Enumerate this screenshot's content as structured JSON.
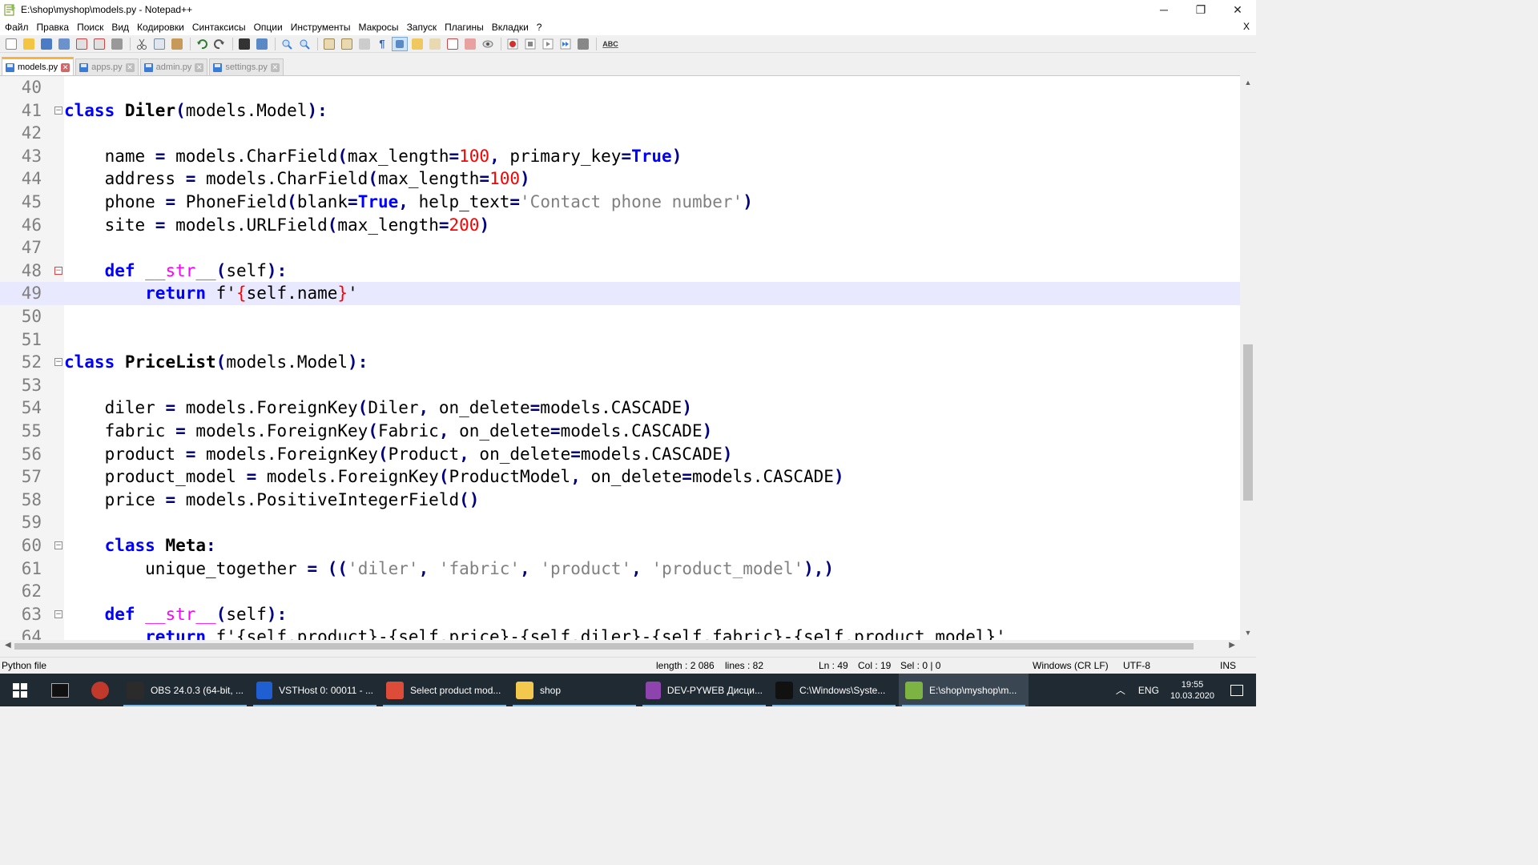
{
  "window": {
    "title": "E:\\shop\\myshop\\models.py - Notepad++",
    "minimize": "─",
    "maximize": "❐",
    "close": "✕"
  },
  "menu": {
    "items": [
      "Файл",
      "Правка",
      "Поиск",
      "Вид",
      "Кодировки",
      "Синтаксисы",
      "Опции",
      "Инструменты",
      "Макросы",
      "Запуск",
      "Плагины",
      "Вкладки",
      "?"
    ],
    "close_doc": "X"
  },
  "toolbar": {
    "spellcheck_label": "ABC"
  },
  "tabs": [
    {
      "label": "models.py",
      "active": true
    },
    {
      "label": "apps.py",
      "active": false
    },
    {
      "label": "admin.py",
      "active": false
    },
    {
      "label": "settings.py",
      "active": false
    }
  ],
  "editor": {
    "current_line": 49,
    "lines": [
      {
        "n": "40",
        "fold": "",
        "html": ""
      },
      {
        "n": "41",
        "fold": "⊟",
        "html": "<span class='kw'>class</span> <span class='cls'>Diler</span><span class='op'>(</span>models.Model<span class='op'>):</span>"
      },
      {
        "n": "42",
        "fold": "",
        "html": ""
      },
      {
        "n": "43",
        "fold": "",
        "html": "    name <span class='op'>=</span> models.CharField<span class='op'>(</span>max_length<span class='op'>=</span><span class='num'>100</span><span class='op'>,</span> primary_key<span class='op'>=</span><span class='kw'>True</span><span class='op'>)</span>"
      },
      {
        "n": "44",
        "fold": "",
        "html": "    address <span class='op'>=</span> models.CharField<span class='op'>(</span>max_length<span class='op'>=</span><span class='num'>100</span><span class='op'>)</span>"
      },
      {
        "n": "45",
        "fold": "",
        "html": "    phone <span class='op'>=</span> PhoneField<span class='op'>(</span>blank<span class='op'>=</span><span class='kw'>True</span><span class='op'>,</span> help_text<span class='op'>=</span><span class='str'>'Contact phone number'</span><span class='op'>)</span>"
      },
      {
        "n": "46",
        "fold": "",
        "html": "    site <span class='op'>=</span> models.URLField<span class='op'>(</span>max_length<span class='op'>=</span><span class='num'>200</span><span class='op'>)</span>"
      },
      {
        "n": "47",
        "fold": "",
        "html": ""
      },
      {
        "n": "48",
        "fold": "⊟",
        "html": "    <span class='kw'>def</span> <span class='magic'>__str__</span><span class='op'>(</span>self<span class='op'>):</span>"
      },
      {
        "n": "49",
        "fold": "",
        "html": "        <span class='kw'>return</span> f'<span class='brace'>{</span>self.name<span class='brace'>}</span>'"
      },
      {
        "n": "50",
        "fold": "",
        "html": ""
      },
      {
        "n": "51",
        "fold": "",
        "html": ""
      },
      {
        "n": "52",
        "fold": "⊟",
        "html": "<span class='kw'>class</span> <span class='cls'>PriceList</span><span class='op'>(</span>models.Model<span class='op'>):</span>"
      },
      {
        "n": "53",
        "fold": "",
        "html": ""
      },
      {
        "n": "54",
        "fold": "",
        "html": "    diler <span class='op'>=</span> models.ForeignKey<span class='op'>(</span>Diler<span class='op'>,</span> on_delete<span class='op'>=</span>models.CASCADE<span class='op'>)</span>"
      },
      {
        "n": "55",
        "fold": "",
        "html": "    fabric <span class='op'>=</span> models.ForeignKey<span class='op'>(</span>Fabric<span class='op'>,</span> on_delete<span class='op'>=</span>models.CASCADE<span class='op'>)</span>"
      },
      {
        "n": "56",
        "fold": "",
        "html": "    product <span class='op'>=</span> models.ForeignKey<span class='op'>(</span>Product<span class='op'>,</span> on_delete<span class='op'>=</span>models.CASCADE<span class='op'>)</span>"
      },
      {
        "n": "57",
        "fold": "",
        "html": "    product_model <span class='op'>=</span> models.ForeignKey<span class='op'>(</span>ProductModel<span class='op'>,</span> on_delete<span class='op'>=</span>models.CASCADE<span class='op'>)</span>"
      },
      {
        "n": "58",
        "fold": "",
        "html": "    price <span class='op'>=</span> models.PositiveIntegerField<span class='op'>()</span>"
      },
      {
        "n": "59",
        "fold": "",
        "html": ""
      },
      {
        "n": "60",
        "fold": "⊟",
        "html": "    <span class='kw'>class</span> <span class='cls'>Meta</span><span class='op'>:</span>"
      },
      {
        "n": "61",
        "fold": "",
        "html": "        unique_together <span class='op'>=</span> <span class='op'>((</span><span class='str'>'diler'</span><span class='op'>,</span> <span class='str'>'fabric'</span><span class='op'>,</span> <span class='str'>'product'</span><span class='op'>,</span> <span class='str'>'product_model'</span><span class='op'>),)</span>"
      },
      {
        "n": "62",
        "fold": "",
        "html": ""
      },
      {
        "n": "63",
        "fold": "⊟",
        "html": "    <span class='kw'>def</span> <span class='magic'>__str__</span><span class='op'>(</span>self<span class='op'>):</span>"
      },
      {
        "n": "64",
        "fold": "",
        "html": "        <span class='kw'>return</span> f'{self.product}-{self.price}-{self.diler}-{self.fabric}-{self.product_model}'"
      }
    ]
  },
  "status": {
    "file_type": "Python file",
    "length": "length : 2 086",
    "lines": "lines : 82",
    "ln": "Ln : 49",
    "col": "Col : 19",
    "sel": "Sel : 0 | 0",
    "eol": "Windows (CR LF)",
    "encoding": "UTF-8",
    "mode": "INS"
  },
  "taskbar": {
    "items": [
      {
        "label": "OBS 24.0.3 (64-bit, ...",
        "color": "#2b2b2b"
      },
      {
        "label": "VSTHost 0: 00011 - ...",
        "color": "#1f5fd1"
      },
      {
        "label": "Select product mod...",
        "color": "#dd4b39"
      },
      {
        "label": "shop",
        "color": "#f2c94c"
      },
      {
        "label": "DEV-PYWEB Дисци...",
        "color": "#8e44ad"
      },
      {
        "label": "C:\\Windows\\Syste...",
        "color": "#111111"
      },
      {
        "label": "E:\\shop\\myshop\\m...",
        "color": "#7cb342"
      }
    ],
    "lang": "ENG",
    "time": "19:55",
    "date": "10.03.2020"
  }
}
